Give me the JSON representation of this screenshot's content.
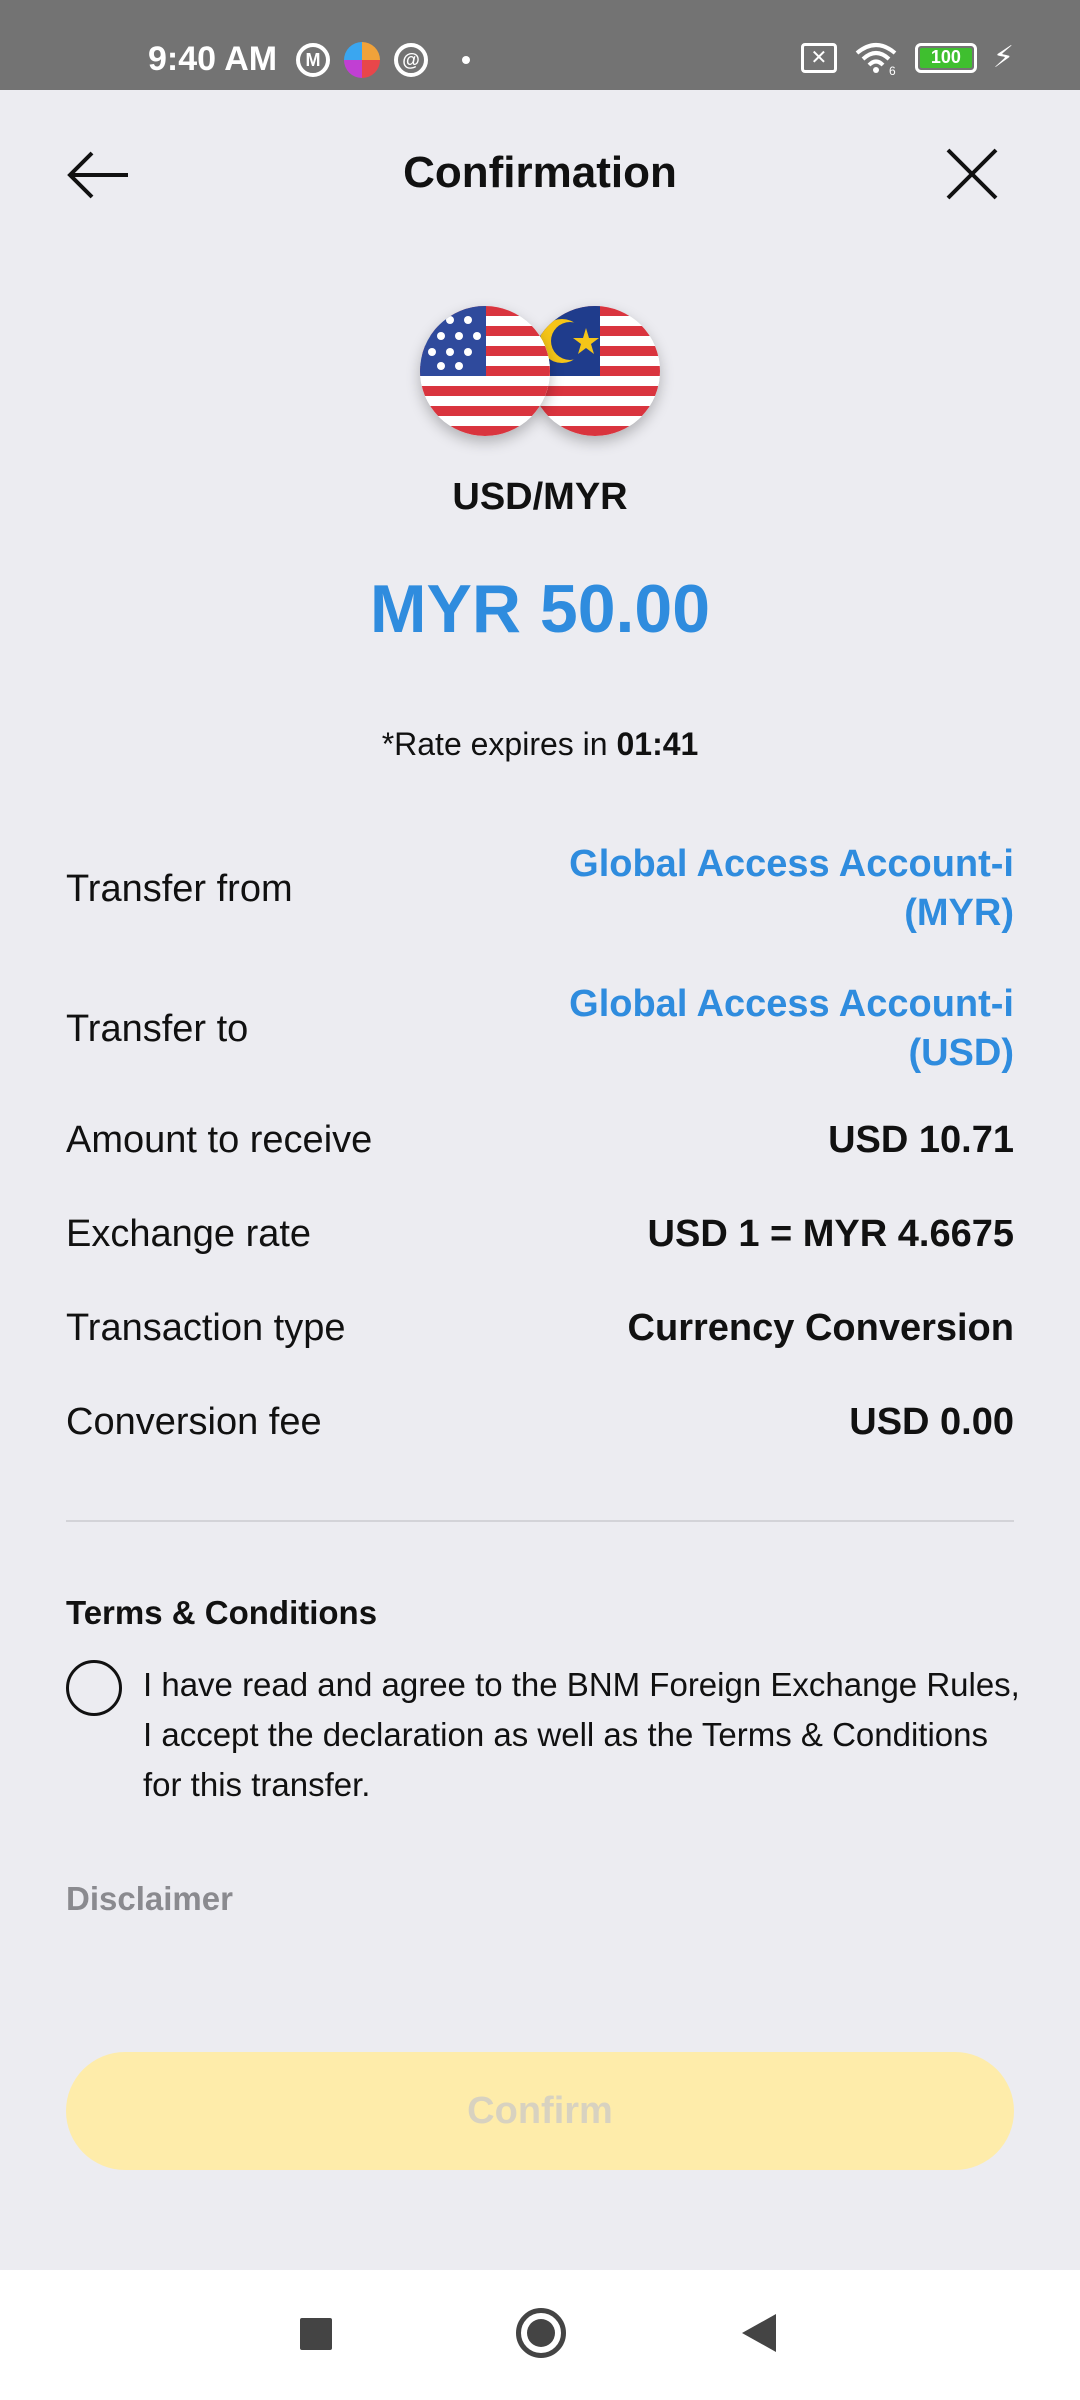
{
  "status_bar": {
    "time": "9:40 AM",
    "icons_left": [
      "m-app-icon",
      "color-app-icon",
      "at-app-icon",
      "notification-dot-icon"
    ],
    "icons_right": [
      "no-sim-icon",
      "wifi-icon",
      "battery-icon",
      "charging-icon"
    ],
    "wifi_label": "6",
    "battery_level": "100"
  },
  "header": {
    "title": "Confirmation",
    "back_icon": "arrow-left-icon",
    "close_icon": "close-icon"
  },
  "currency": {
    "pair": "USD/MYR",
    "amount": "MYR 50.00",
    "flags": [
      "us-flag-icon",
      "malaysia-flag-icon"
    ]
  },
  "rate_expiry": {
    "prefix": "*Rate expires in ",
    "time": "01:41"
  },
  "details": {
    "transfer_from": {
      "label": "Transfer from",
      "value_line1": "Global Access Account-i",
      "value_line2": "(MYR)"
    },
    "transfer_to": {
      "label": "Transfer to",
      "value_line1": "Global Access Account-i",
      "value_line2": "(USD)"
    },
    "amount_to_receive": {
      "label": "Amount to receive",
      "value": "USD 10.71"
    },
    "exchange_rate": {
      "label": "Exchange rate",
      "value": "USD 1 = MYR 4.6675"
    },
    "transaction_type": {
      "label": "Transaction type",
      "value": "Currency Conversion"
    },
    "conversion_fee": {
      "label": "Conversion fee",
      "value": "USD 0.00"
    }
  },
  "terms": {
    "title": "Terms & Conditions",
    "text": "I have read and agree to the BNM Foreign Exchange Rules, I accept the declaration as well as the Terms & Conditions for this transfer.",
    "checked": false
  },
  "disclaimer": {
    "label": "Disclaimer"
  },
  "confirm": {
    "label": "Confirm",
    "enabled": false
  },
  "colors": {
    "accent": "#2F8CDE",
    "background": "#ECECF1",
    "confirm_disabled": "#FEECAA",
    "status_bar": "#737373",
    "battery": "#3FBF2F"
  },
  "nav_bar": {
    "icons": [
      "recents-square-icon",
      "home-circle-icon",
      "back-triangle-icon"
    ]
  }
}
